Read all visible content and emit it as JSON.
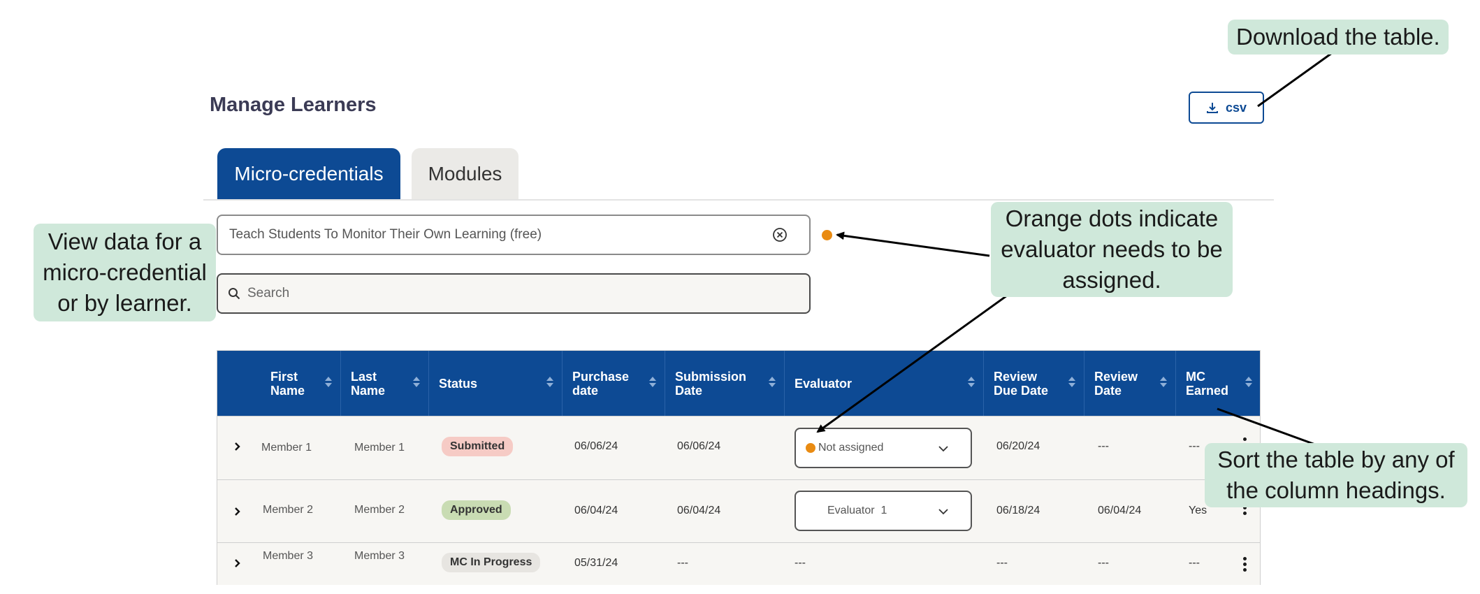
{
  "page": {
    "title": "Manage Learners",
    "csv_label": "csv"
  },
  "tabs": [
    {
      "label": "Micro-credentials",
      "active": true
    },
    {
      "label": "Modules",
      "active": false
    }
  ],
  "selector": {
    "value": "Teach Students To Monitor Their Own Learning (free)",
    "indicator_color": "#e98b12"
  },
  "search": {
    "placeholder": "Search"
  },
  "table": {
    "columns": [
      "First\nName",
      "Last\nName",
      "Status",
      "Purchase\ndate",
      "Submission\nDate",
      "Evaluator",
      "Review\nDue Date",
      "Review\nDate",
      "MC\nEarned"
    ],
    "rows": [
      {
        "first": "Member 1",
        "last": "Member 1",
        "status": "Submitted",
        "purchase": "06/06/24",
        "submission": "06/06/24",
        "evaluator": "Not assigned",
        "due": "06/20/24",
        "review": "---",
        "earned": "---"
      },
      {
        "first": "Member 2",
        "last": "Member 2",
        "status": "Approved",
        "purchase": "06/04/24",
        "submission": "06/04/24",
        "evaluator": "Evaluator  1",
        "due": "06/18/24",
        "review": "06/04/24",
        "earned": "Yes"
      },
      {
        "first": "Member 3",
        "last": "Member 3",
        "status": "MC In Progress",
        "purchase": "05/31/24",
        "submission": "---",
        "evaluator": "---",
        "due": "---",
        "review": "---",
        "earned": "---"
      }
    ]
  },
  "callouts": {
    "download": "Download the table.",
    "view_data": "View data for a\nmicro-credential\nor by learner.",
    "orange_dots": "Orange dots indicate\nevaluator needs to be\nassigned.",
    "sort": "Sort the table by any of\nthe column headings."
  },
  "colors": {
    "primary": "#0d4a94",
    "callout_bg": "#cfe8da",
    "orange": "#e98b12",
    "submitted": "#f6cbc5",
    "approved": "#c9dcb3"
  }
}
